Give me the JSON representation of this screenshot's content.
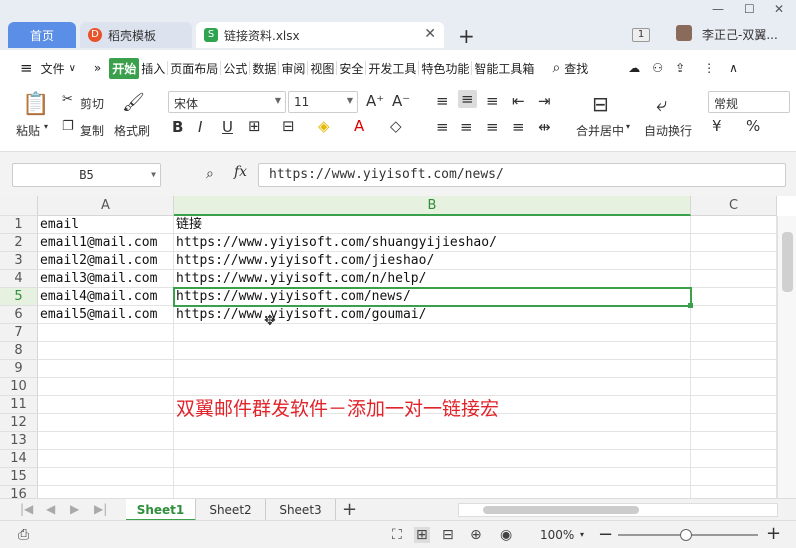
{
  "tabs": {
    "home": "首页",
    "template": "稻壳模板",
    "file": "链接资料.xlsx",
    "add": "+"
  },
  "titlebar": {
    "badge": "1",
    "user": "李正己-双翼..."
  },
  "menu": {
    "file": "文件",
    "more": "»",
    "items": [
      "开始",
      "插入",
      "页面布局",
      "公式",
      "数据",
      "审阅",
      "视图",
      "安全",
      "开发工具",
      "特色功能",
      "智能工具箱"
    ],
    "search": "查找"
  },
  "ribbon": {
    "paste": "粘贴",
    "cut": "剪切",
    "copy": "复制",
    "format_painter": "格式刷",
    "font_name": "宋体",
    "font_size": "11",
    "merge_center": "合并居中",
    "wrap": "自动换行",
    "number_format": "常规"
  },
  "formula_bar": {
    "name_box": "B5",
    "fx": "fx",
    "value": "https://www.yiyisoft.com/news/"
  },
  "grid": {
    "columns": [
      "A",
      "B",
      "C"
    ],
    "rows": [
      "1",
      "2",
      "3",
      "4",
      "5",
      "6",
      "7",
      "8",
      "9",
      "10",
      "11",
      "12",
      "13",
      "14",
      "15",
      "16"
    ],
    "selected_row": "5",
    "selected_col": "B",
    "cells": [
      [
        "email",
        "链接"
      ],
      [
        "email1@mail.com",
        "https://www.yiyisoft.com/shuangyijieshao/"
      ],
      [
        "email2@mail.com",
        "https://www.yiyisoft.com/jieshao/"
      ],
      [
        "email3@mail.com",
        "https://www.yiyisoft.com/n/help/"
      ],
      [
        "email4@mail.com",
        "https://www.yiyisoft.com/news/"
      ],
      [
        "email5@mail.com",
        "https://www.yiyisoft.com/goumai/"
      ]
    ],
    "overlay": "双翼邮件群发软件－添加一对一链接宏"
  },
  "sheets": {
    "tabs": [
      "Sheet1",
      "Sheet2",
      "Sheet3"
    ],
    "active": "Sheet1",
    "add": "+"
  },
  "status": {
    "zoom": "100%",
    "minus": "−",
    "plus": "+"
  },
  "colors": {
    "accent": "#3aa04b",
    "tab_blue": "#5b8ee6",
    "overlay_red": "#e0242a"
  }
}
